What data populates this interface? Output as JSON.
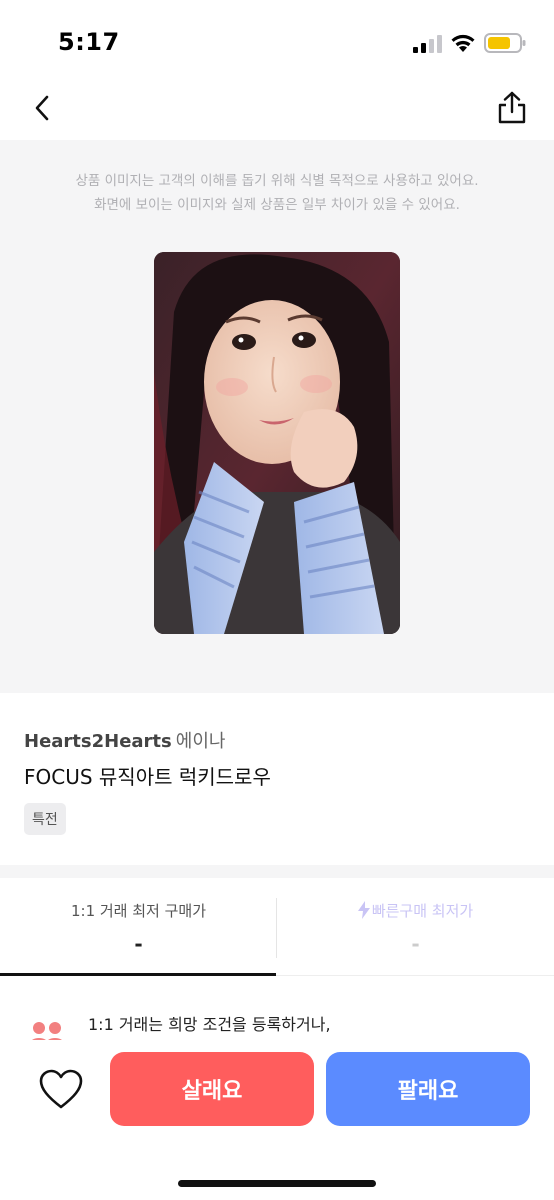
{
  "status_bar": {
    "time": "5:17"
  },
  "image_notice": {
    "line1": "상품 이미지는 고객의 이해를 돕기 위해 식별 목적으로 사용하고 있어요.",
    "line2": "화면에 보이는 이미지와 실제 상품은 일부 차이가 있을 수 있어요."
  },
  "product": {
    "artist": "Hearts2Hearts",
    "member": "에이나",
    "title": "FOCUS 뮤직아트 럭키드로우",
    "tag": "특전"
  },
  "tabs": [
    {
      "label": "1:1 거래 최저 구매가",
      "value": "-",
      "active": true
    },
    {
      "label": "빠른구매 최저가",
      "value": "-",
      "active": false
    }
  ],
  "notice": {
    "line1": "1:1 거래는 희망 조건을 등록하거나,"
  },
  "actions": {
    "buy_label": "살래요",
    "sell_label": "팔래요"
  },
  "colors": {
    "buy": "#ff5d5d",
    "sell": "#5b8bff",
    "quick_buy": "#c9c4f5"
  }
}
